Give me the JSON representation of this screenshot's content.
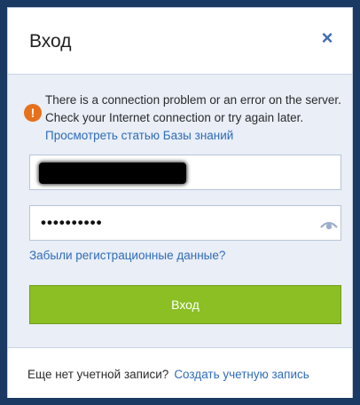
{
  "dialog": {
    "title": "Вход",
    "close_icon": "close-icon",
    "close_glyph": "×"
  },
  "error": {
    "icon": "warning-icon",
    "glyph": "!",
    "message": "There is a connection problem or an error on the server. Check your Internet connection or try again later.",
    "link_text": "Просмотреть статью Базы знаний",
    "color": "#e7711b"
  },
  "form": {
    "username_value": "",
    "password_value": "••••••••••",
    "show_password_icon": "eye-icon",
    "forgot_link": "Забыли регистрационные данные?",
    "login_button": "Вход"
  },
  "footer": {
    "prompt": "Еще нет учетной записи?",
    "create_link": "Создать учетную запись"
  },
  "colors": {
    "accent": "#2f6cb8",
    "button": "#8bbf24"
  }
}
